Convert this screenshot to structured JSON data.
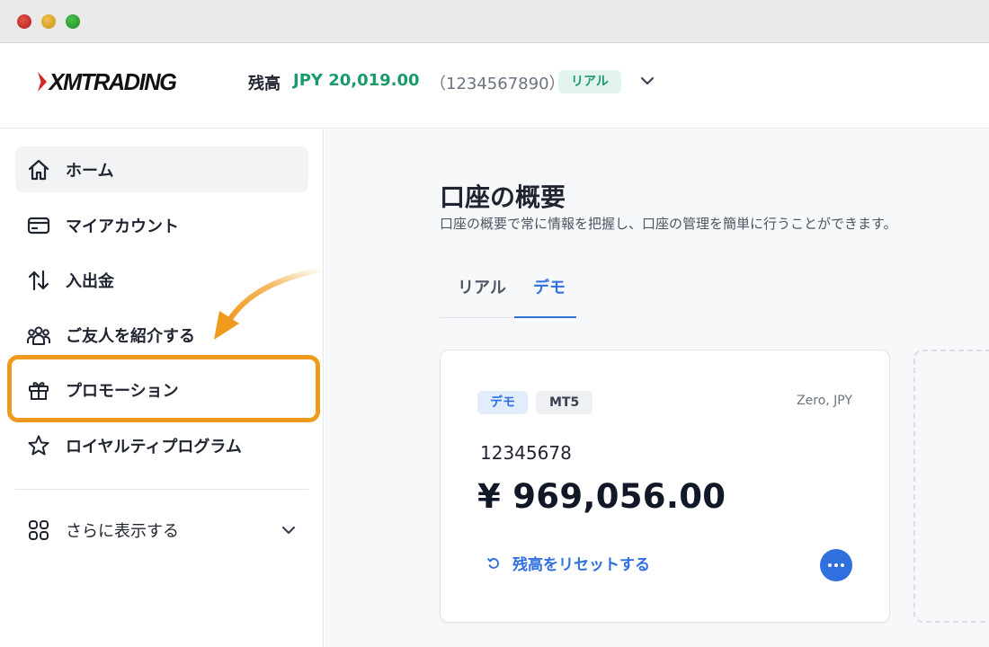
{
  "window": {
    "controls": [
      "close",
      "minimize",
      "maximize"
    ]
  },
  "header": {
    "logo_text": "XMTRADING",
    "balance_label": "残高",
    "balance_value": "JPY 20,019.00",
    "account_number": "（1234567890）",
    "account_type_badge": "リアル",
    "colors": {
      "balance": "#1a9a68",
      "badge_bg": "#e3f4ee"
    }
  },
  "sidebar": {
    "items": [
      {
        "label": "ホーム",
        "icon": "home-icon",
        "active": true
      },
      {
        "label": "マイアカウント",
        "icon": "card-icon",
        "active": false
      },
      {
        "label": "入出金",
        "icon": "transfer-arrows-icon",
        "active": false
      },
      {
        "label": "ご友人を紹介する",
        "icon": "users-icon",
        "active": false
      },
      {
        "label": "プロモーション",
        "icon": "gift-icon",
        "active": false,
        "highlighted": true
      },
      {
        "label": "ロイヤルティプログラム",
        "icon": "star-icon",
        "active": false
      }
    ],
    "more": {
      "label": "さらに表示する",
      "icon": "grid-icon"
    }
  },
  "main": {
    "title": "口座の概要",
    "subtitle": "口座の概要で常に情報を把握し、口座の管理を簡単に行うことができます。",
    "tabs": [
      {
        "label": "リアル",
        "selected": false
      },
      {
        "label": "デモ",
        "selected": true
      }
    ],
    "account_card": {
      "type_badge": "デモ",
      "platform_badge": "MT5",
      "account_type": "Zero, JPY",
      "account_number": "12345678",
      "balance": "¥ 969,056.00",
      "reset_label": "残高をリセットする"
    }
  },
  "annotation": {
    "highlight_color": "#f09a1d"
  },
  "accent_color": "#2f6fde"
}
